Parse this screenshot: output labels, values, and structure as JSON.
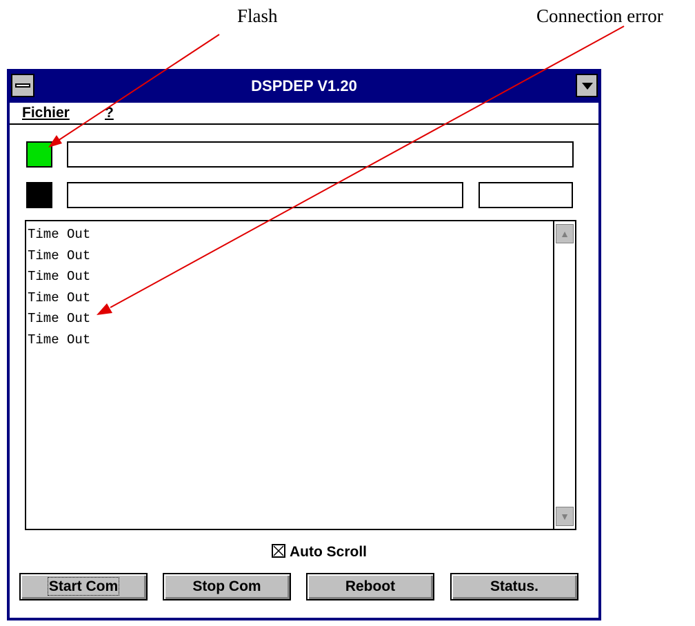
{
  "annotations": {
    "flash_label": "Flash",
    "error_label": "Connection error",
    "arrow_color": "#e00000"
  },
  "window": {
    "title": "DSPDEP V1.20",
    "title_bg": "#000080",
    "sysmenu_icon": "system-menu-icon",
    "minimize_icon": "minimize-arrow-icon"
  },
  "menu": {
    "items": [
      {
        "label": "Fichier"
      },
      {
        "label": "?"
      }
    ]
  },
  "indicators": {
    "flash_led_color": "#00e000",
    "status_led_color": "#000000"
  },
  "log": {
    "lines": [
      "Time Out",
      "Time Out",
      "Time Out",
      "Time Out",
      "Time Out",
      "Time Out"
    ]
  },
  "auto_scroll": {
    "label": "Auto Scroll",
    "checked": true
  },
  "buttons": {
    "start": "Start Com",
    "stop": "Stop Com",
    "reboot": "Reboot",
    "status": "Status."
  }
}
